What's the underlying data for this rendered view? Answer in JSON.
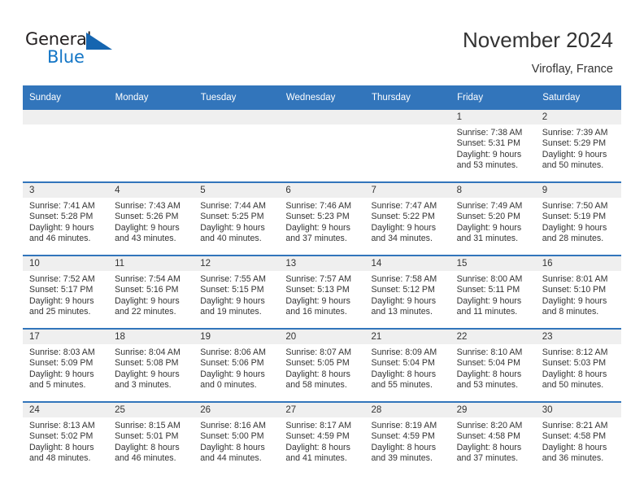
{
  "brand": {
    "name_top": "General",
    "name_bottom": "Blue",
    "triangle_color": "#1565b0",
    "blue_text_color": "#1476c6"
  },
  "header": {
    "title": "November 2024",
    "subtitle": "Viroflay, France"
  },
  "theme": {
    "header_blue": "#3275bb",
    "day_band_gray": "#efefef",
    "text": "#333333"
  },
  "calendar": {
    "weekday_headers": [
      "Sunday",
      "Monday",
      "Tuesday",
      "Wednesday",
      "Thursday",
      "Friday",
      "Saturday"
    ],
    "weeks": [
      [
        {
          "day": "",
          "sunrise": "",
          "sunset": "",
          "daylight1": "",
          "daylight2": "",
          "empty": true
        },
        {
          "day": "",
          "sunrise": "",
          "sunset": "",
          "daylight1": "",
          "daylight2": "",
          "empty": true
        },
        {
          "day": "",
          "sunrise": "",
          "sunset": "",
          "daylight1": "",
          "daylight2": "",
          "empty": true
        },
        {
          "day": "",
          "sunrise": "",
          "sunset": "",
          "daylight1": "",
          "daylight2": "",
          "empty": true
        },
        {
          "day": "",
          "sunrise": "",
          "sunset": "",
          "daylight1": "",
          "daylight2": "",
          "empty": true
        },
        {
          "day": "1",
          "sunrise": "Sunrise: 7:38 AM",
          "sunset": "Sunset: 5:31 PM",
          "daylight1": "Daylight: 9 hours",
          "daylight2": "and 53 minutes."
        },
        {
          "day": "2",
          "sunrise": "Sunrise: 7:39 AM",
          "sunset": "Sunset: 5:29 PM",
          "daylight1": "Daylight: 9 hours",
          "daylight2": "and 50 minutes."
        }
      ],
      [
        {
          "day": "3",
          "sunrise": "Sunrise: 7:41 AM",
          "sunset": "Sunset: 5:28 PM",
          "daylight1": "Daylight: 9 hours",
          "daylight2": "and 46 minutes."
        },
        {
          "day": "4",
          "sunrise": "Sunrise: 7:43 AM",
          "sunset": "Sunset: 5:26 PM",
          "daylight1": "Daylight: 9 hours",
          "daylight2": "and 43 minutes."
        },
        {
          "day": "5",
          "sunrise": "Sunrise: 7:44 AM",
          "sunset": "Sunset: 5:25 PM",
          "daylight1": "Daylight: 9 hours",
          "daylight2": "and 40 minutes."
        },
        {
          "day": "6",
          "sunrise": "Sunrise: 7:46 AM",
          "sunset": "Sunset: 5:23 PM",
          "daylight1": "Daylight: 9 hours",
          "daylight2": "and 37 minutes."
        },
        {
          "day": "7",
          "sunrise": "Sunrise: 7:47 AM",
          "sunset": "Sunset: 5:22 PM",
          "daylight1": "Daylight: 9 hours",
          "daylight2": "and 34 minutes."
        },
        {
          "day": "8",
          "sunrise": "Sunrise: 7:49 AM",
          "sunset": "Sunset: 5:20 PM",
          "daylight1": "Daylight: 9 hours",
          "daylight2": "and 31 minutes."
        },
        {
          "day": "9",
          "sunrise": "Sunrise: 7:50 AM",
          "sunset": "Sunset: 5:19 PM",
          "daylight1": "Daylight: 9 hours",
          "daylight2": "and 28 minutes."
        }
      ],
      [
        {
          "day": "10",
          "sunrise": "Sunrise: 7:52 AM",
          "sunset": "Sunset: 5:17 PM",
          "daylight1": "Daylight: 9 hours",
          "daylight2": "and 25 minutes."
        },
        {
          "day": "11",
          "sunrise": "Sunrise: 7:54 AM",
          "sunset": "Sunset: 5:16 PM",
          "daylight1": "Daylight: 9 hours",
          "daylight2": "and 22 minutes."
        },
        {
          "day": "12",
          "sunrise": "Sunrise: 7:55 AM",
          "sunset": "Sunset: 5:15 PM",
          "daylight1": "Daylight: 9 hours",
          "daylight2": "and 19 minutes."
        },
        {
          "day": "13",
          "sunrise": "Sunrise: 7:57 AM",
          "sunset": "Sunset: 5:13 PM",
          "daylight1": "Daylight: 9 hours",
          "daylight2": "and 16 minutes."
        },
        {
          "day": "14",
          "sunrise": "Sunrise: 7:58 AM",
          "sunset": "Sunset: 5:12 PM",
          "daylight1": "Daylight: 9 hours",
          "daylight2": "and 13 minutes."
        },
        {
          "day": "15",
          "sunrise": "Sunrise: 8:00 AM",
          "sunset": "Sunset: 5:11 PM",
          "daylight1": "Daylight: 9 hours",
          "daylight2": "and 11 minutes."
        },
        {
          "day": "16",
          "sunrise": "Sunrise: 8:01 AM",
          "sunset": "Sunset: 5:10 PM",
          "daylight1": "Daylight: 9 hours",
          "daylight2": "and 8 minutes."
        }
      ],
      [
        {
          "day": "17",
          "sunrise": "Sunrise: 8:03 AM",
          "sunset": "Sunset: 5:09 PM",
          "daylight1": "Daylight: 9 hours",
          "daylight2": "and 5 minutes."
        },
        {
          "day": "18",
          "sunrise": "Sunrise: 8:04 AM",
          "sunset": "Sunset: 5:08 PM",
          "daylight1": "Daylight: 9 hours",
          "daylight2": "and 3 minutes."
        },
        {
          "day": "19",
          "sunrise": "Sunrise: 8:06 AM",
          "sunset": "Sunset: 5:06 PM",
          "daylight1": "Daylight: 9 hours",
          "daylight2": "and 0 minutes."
        },
        {
          "day": "20",
          "sunrise": "Sunrise: 8:07 AM",
          "sunset": "Sunset: 5:05 PM",
          "daylight1": "Daylight: 8 hours",
          "daylight2": "and 58 minutes."
        },
        {
          "day": "21",
          "sunrise": "Sunrise: 8:09 AM",
          "sunset": "Sunset: 5:04 PM",
          "daylight1": "Daylight: 8 hours",
          "daylight2": "and 55 minutes."
        },
        {
          "day": "22",
          "sunrise": "Sunrise: 8:10 AM",
          "sunset": "Sunset: 5:04 PM",
          "daylight1": "Daylight: 8 hours",
          "daylight2": "and 53 minutes."
        },
        {
          "day": "23",
          "sunrise": "Sunrise: 8:12 AM",
          "sunset": "Sunset: 5:03 PM",
          "daylight1": "Daylight: 8 hours",
          "daylight2": "and 50 minutes."
        }
      ],
      [
        {
          "day": "24",
          "sunrise": "Sunrise: 8:13 AM",
          "sunset": "Sunset: 5:02 PM",
          "daylight1": "Daylight: 8 hours",
          "daylight2": "and 48 minutes."
        },
        {
          "day": "25",
          "sunrise": "Sunrise: 8:15 AM",
          "sunset": "Sunset: 5:01 PM",
          "daylight1": "Daylight: 8 hours",
          "daylight2": "and 46 minutes."
        },
        {
          "day": "26",
          "sunrise": "Sunrise: 8:16 AM",
          "sunset": "Sunset: 5:00 PM",
          "daylight1": "Daylight: 8 hours",
          "daylight2": "and 44 minutes."
        },
        {
          "day": "27",
          "sunrise": "Sunrise: 8:17 AM",
          "sunset": "Sunset: 4:59 PM",
          "daylight1": "Daylight: 8 hours",
          "daylight2": "and 41 minutes."
        },
        {
          "day": "28",
          "sunrise": "Sunrise: 8:19 AM",
          "sunset": "Sunset: 4:59 PM",
          "daylight1": "Daylight: 8 hours",
          "daylight2": "and 39 minutes."
        },
        {
          "day": "29",
          "sunrise": "Sunrise: 8:20 AM",
          "sunset": "Sunset: 4:58 PM",
          "daylight1": "Daylight: 8 hours",
          "daylight2": "and 37 minutes."
        },
        {
          "day": "30",
          "sunrise": "Sunrise: 8:21 AM",
          "sunset": "Sunset: 4:58 PM",
          "daylight1": "Daylight: 8 hours",
          "daylight2": "and 36 minutes."
        }
      ]
    ]
  }
}
